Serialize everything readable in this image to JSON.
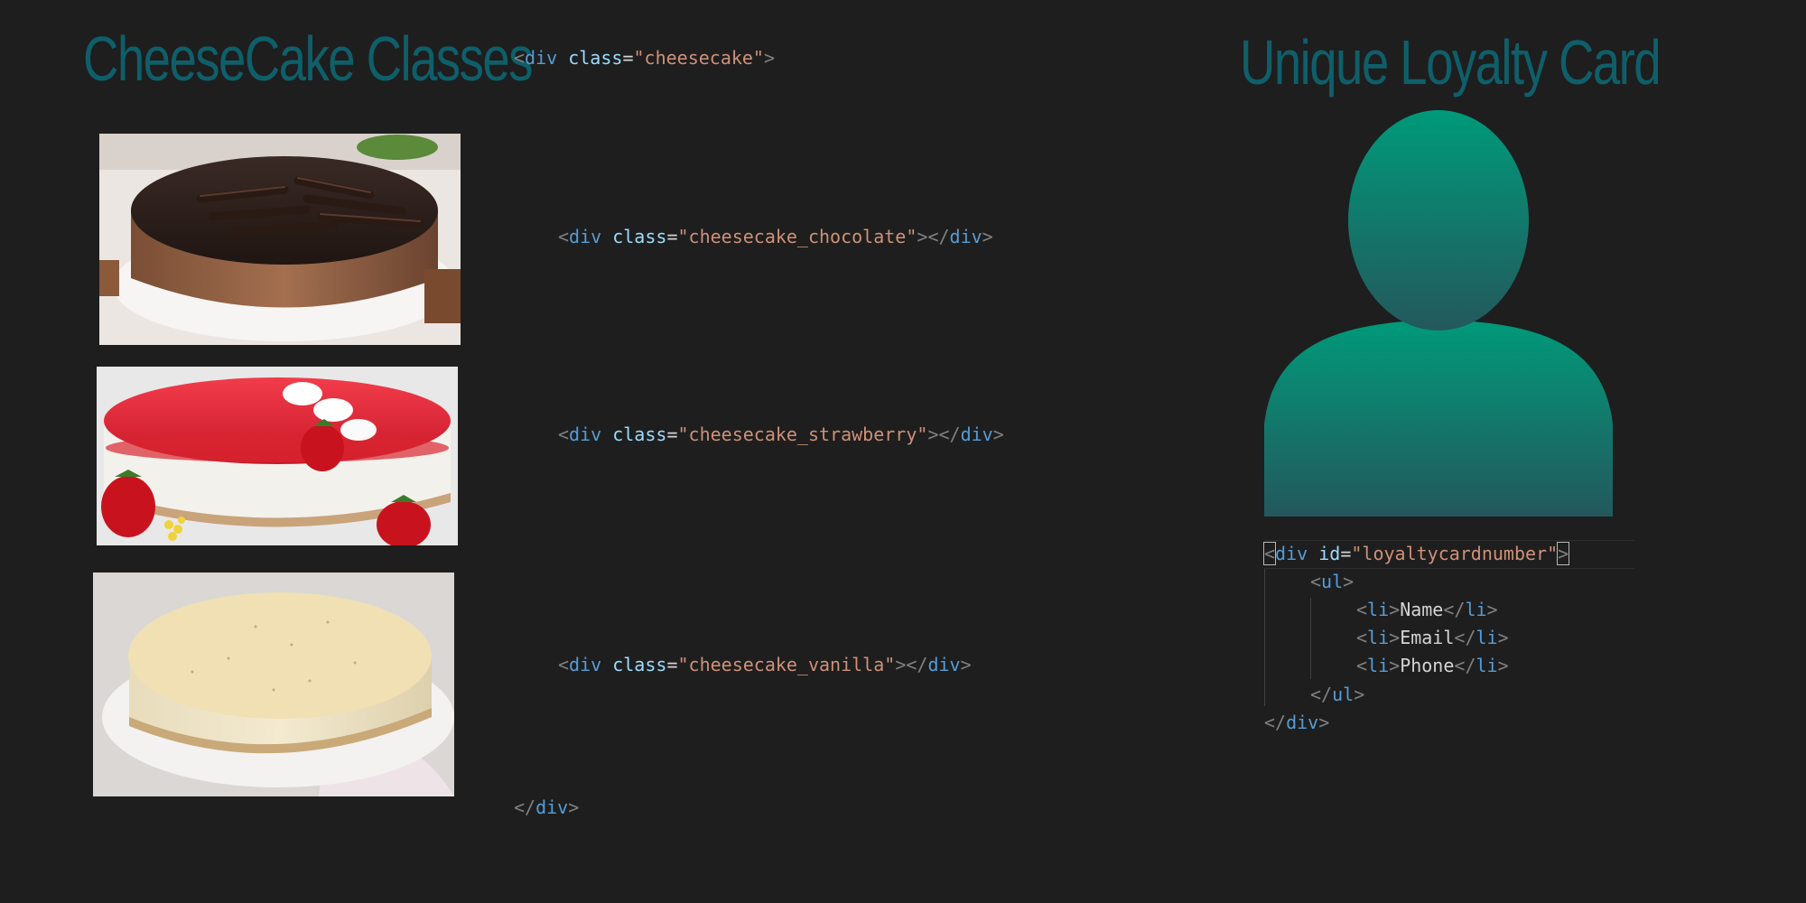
{
  "left": {
    "title": "CheeseCake Classes",
    "images": [
      {
        "name": "chocolate cheesecake"
      },
      {
        "name": "strawberry cheesecake"
      },
      {
        "name": "vanilla cheesecake"
      }
    ]
  },
  "code": {
    "tag": "div",
    "attr": "class",
    "eq": "=",
    "lt": "<",
    "gt": ">",
    "close_open": "</",
    "outer_class": "\"cheesecake\"",
    "chocolate_class": "\"cheesecake_chocolate\"",
    "strawberry_class": "\"cheesecake_strawberry\"",
    "vanilla_class": "\"cheesecake_vanilla\""
  },
  "right": {
    "title": "Unique Loyalty Card",
    "avatar_icon": "person-silhouette-icon",
    "colors": {
      "avatar_top": "#009a7a",
      "avatar_bottom": "#24585c",
      "title": "#0e5f6a"
    },
    "snippet": {
      "div_tag": "div",
      "id_attr": "id",
      "id_value": "\"loyaltycardnumber\"",
      "ul_tag": "ul",
      "li_tag": "li",
      "items": [
        "Name",
        "Email",
        "Phone"
      ]
    }
  }
}
